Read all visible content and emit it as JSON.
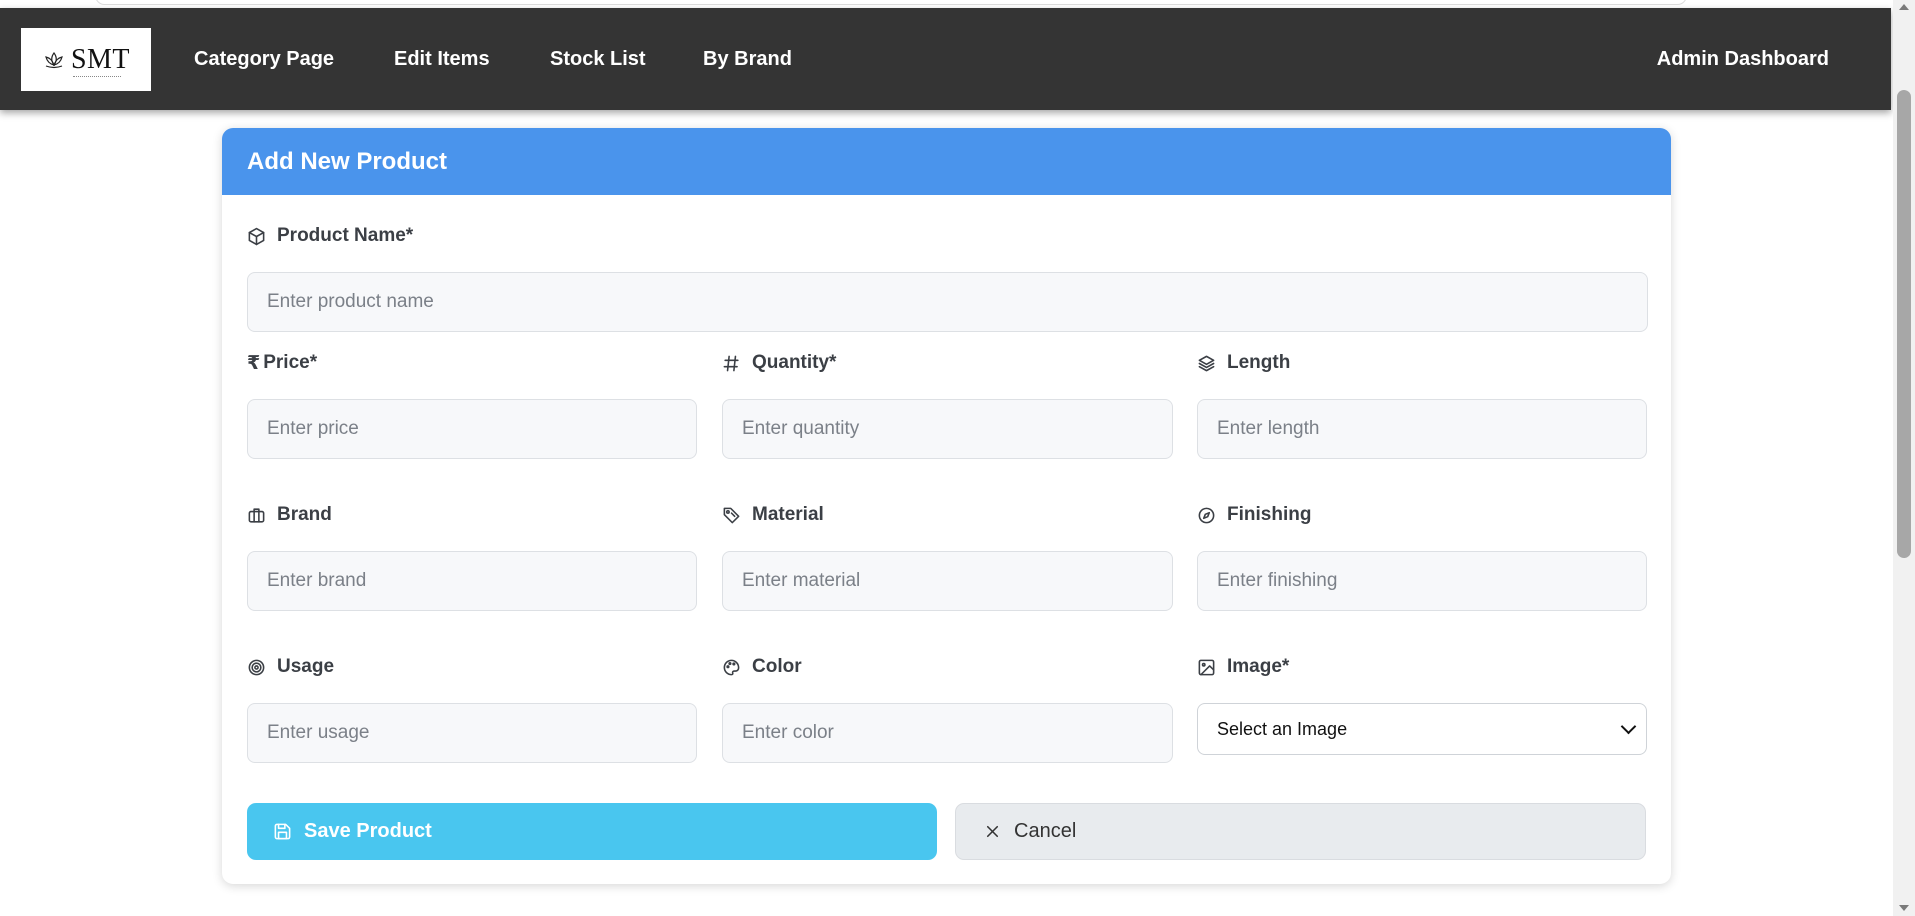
{
  "navbar": {
    "logo_text": "SMT",
    "links": [
      "Category Page",
      "Edit Items",
      "Stock List",
      "By Brand"
    ],
    "admin_link": "Admin Dashboard"
  },
  "form": {
    "title": "Add New Product",
    "product_name": {
      "label": "Product Name*",
      "placeholder": "Enter product name",
      "icon": "box-icon"
    },
    "price": {
      "label": "Price*",
      "placeholder": "Enter price",
      "icon": "rupee-icon"
    },
    "quantity": {
      "label": "Quantity*",
      "placeholder": "Enter quantity",
      "icon": "hash-icon"
    },
    "length": {
      "label": "Length",
      "placeholder": "Enter length",
      "icon": "layers-icon"
    },
    "brand": {
      "label": "Brand",
      "placeholder": "Enter brand",
      "icon": "briefcase-icon"
    },
    "material": {
      "label": "Material",
      "placeholder": "Enter material",
      "icon": "tag-icon"
    },
    "finishing": {
      "label": "Finishing",
      "placeholder": "Enter finishing",
      "icon": "compass-icon"
    },
    "usage": {
      "label": "Usage",
      "placeholder": "Enter usage",
      "icon": "target-icon"
    },
    "color": {
      "label": "Color",
      "placeholder": "Enter color",
      "icon": "palette-icon"
    },
    "image": {
      "label": "Image*",
      "selected": "Select an Image",
      "icon": "image-icon"
    },
    "save_label": "Save Product",
    "cancel_label": "Cancel"
  },
  "colors": {
    "navbar": "#343434",
    "header": "#4a94ec",
    "save_button": "#49c6ef",
    "cancel_button": "#e8ebee"
  }
}
